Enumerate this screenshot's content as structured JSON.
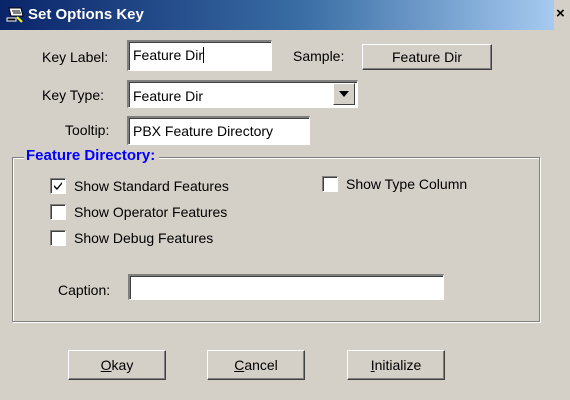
{
  "window": {
    "title": "Set Options Key",
    "close_glyph": "×",
    "icon": "key-icon"
  },
  "key_label": {
    "label": "Key Label:",
    "value": "Feature Dir"
  },
  "sample": {
    "label": "Sample:",
    "button_text": "Feature Dir"
  },
  "key_type": {
    "label": "Key Type:",
    "selected": "Feature Dir"
  },
  "tooltip": {
    "label": "Tooltip:",
    "value": "PBX Feature Directory"
  },
  "feature_directory": {
    "title": "Feature Directory:",
    "options": [
      {
        "label": "Show Standard Features",
        "checked": true
      },
      {
        "label": "Show Operator Features",
        "checked": false
      },
      {
        "label": "Show Debug Features",
        "checked": false
      },
      {
        "label": "Show Type Column",
        "checked": false
      }
    ],
    "caption_label": "Caption:",
    "caption_value": ""
  },
  "buttons": {
    "okay": {
      "mnemonic": "O",
      "rest": "kay"
    },
    "cancel": {
      "mnemonic": "C",
      "rest": "ancel"
    },
    "initialize": {
      "mnemonic": "I",
      "rest": "nitialize"
    }
  },
  "colors": {
    "title_bar_start": "#0a246a",
    "title_bar_end": "#a6caf0",
    "dialog_face": "#d4d0c8",
    "group_title": "#0000ff"
  }
}
